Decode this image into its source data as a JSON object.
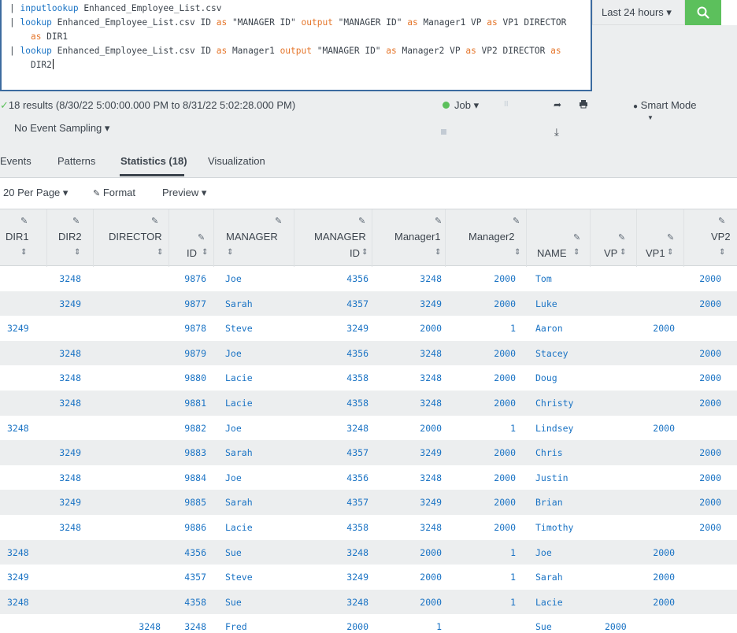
{
  "search": {
    "line1_pipe": "| ",
    "line1_cmd": "inputlookup",
    "line1_rest": " Enhanced_Employee_List.csv",
    "line2_pipe": "| ",
    "line2_cmd": "lookup",
    "line2_a": " Enhanced_Employee_List.csv ID ",
    "line2_as1": "as",
    "line2_b": " \"MANAGER ID\" ",
    "line2_output": "output",
    "line2_c": " \"MANAGER ID\" ",
    "line2_as2": "as",
    "line2_d": " Manager1 VP ",
    "line2_as3": "as",
    "line2_e": " VP1 DIRECTOR",
    "line3_as": "as",
    "line3_rest": " DIR1",
    "line4_pipe": "| ",
    "line4_cmd": "lookup",
    "line4_a": " Enhanced_Employee_List.csv ID ",
    "line4_as1": "as",
    "line4_b": " Manager1 ",
    "line4_output": "output",
    "line4_c": " \"MANAGER ID\" ",
    "line4_as2": "as",
    "line4_d": " Manager2 VP ",
    "line4_as3": "as",
    "line4_e": " VP2 DIRECTOR ",
    "line4_as4": "as",
    "line5_rest": "DIR2"
  },
  "time_picker": "Last 24 hours ▾",
  "status": {
    "check": "✓",
    "results": "18 results (8/30/22 5:00:00.000 PM to 8/31/22 5:02:28.000 PM)",
    "sampling": "No Event Sampling ▾",
    "job": "Job ▾",
    "pause": "II",
    "share_icon": "➦",
    "print_icon": "🖶",
    "export_icon": "⤓",
    "smart_mode": "Smart Mode",
    "smart_caret": "▼",
    "smart_icon": "💡"
  },
  "tabs": [
    {
      "label": "Events"
    },
    {
      "label": "Patterns"
    },
    {
      "label": "Statistics (18)"
    },
    {
      "label": "Visualization"
    }
  ],
  "controls": {
    "per_page": "20 Per Page ▾",
    "format": "Format",
    "preview": "Preview ▾"
  },
  "columns": {
    "dir1": "DIR1",
    "dir2": "DIR2",
    "director": "DIRECTOR",
    "id": "ID",
    "manager": "MANAGER",
    "manager_id_1": "MANAGER",
    "manager_id_2": "ID",
    "manager1": "Manager1",
    "manager2": "Manager2",
    "name": "NAME",
    "vp": "VP",
    "vp1": "VP1",
    "vp2": "VP2",
    "sort_glyph": "⇕",
    "edit_glyph": "✎"
  },
  "rows": [
    {
      "dir1": "",
      "dir2": "3248",
      "director": "",
      "id": "9876",
      "manager": "Joe",
      "manager_id": "4356",
      "manager1": "3248",
      "manager2": "2000",
      "name": "Tom",
      "vp": "",
      "vp1": "",
      "vp2": "2000"
    },
    {
      "dir1": "",
      "dir2": "3249",
      "director": "",
      "id": "9877",
      "manager": "Sarah",
      "manager_id": "4357",
      "manager1": "3249",
      "manager2": "2000",
      "name": "Luke",
      "vp": "",
      "vp1": "",
      "vp2": "2000"
    },
    {
      "dir1": "3249",
      "dir2": "",
      "director": "",
      "id": "9878",
      "manager": "Steve",
      "manager_id": "3249",
      "manager1": "2000",
      "manager2": "1",
      "name": "Aaron",
      "vp": "",
      "vp1": "2000",
      "vp2": ""
    },
    {
      "dir1": "",
      "dir2": "3248",
      "director": "",
      "id": "9879",
      "manager": "Joe",
      "manager_id": "4356",
      "manager1": "3248",
      "manager2": "2000",
      "name": "Stacey",
      "vp": "",
      "vp1": "",
      "vp2": "2000"
    },
    {
      "dir1": "",
      "dir2": "3248",
      "director": "",
      "id": "9880",
      "manager": "Lacie",
      "manager_id": "4358",
      "manager1": "3248",
      "manager2": "2000",
      "name": "Doug",
      "vp": "",
      "vp1": "",
      "vp2": "2000"
    },
    {
      "dir1": "",
      "dir2": "3248",
      "director": "",
      "id": "9881",
      "manager": "Lacie",
      "manager_id": "4358",
      "manager1": "3248",
      "manager2": "2000",
      "name": "Christy",
      "vp": "",
      "vp1": "",
      "vp2": "2000"
    },
    {
      "dir1": "3248",
      "dir2": "",
      "director": "",
      "id": "9882",
      "manager": "Joe",
      "manager_id": "3248",
      "manager1": "2000",
      "manager2": "1",
      "name": "Lindsey",
      "vp": "",
      "vp1": "2000",
      "vp2": ""
    },
    {
      "dir1": "",
      "dir2": "3249",
      "director": "",
      "id": "9883",
      "manager": "Sarah",
      "manager_id": "4357",
      "manager1": "3249",
      "manager2": "2000",
      "name": "Chris",
      "vp": "",
      "vp1": "",
      "vp2": "2000"
    },
    {
      "dir1": "",
      "dir2": "3248",
      "director": "",
      "id": "9884",
      "manager": "Joe",
      "manager_id": "4356",
      "manager1": "3248",
      "manager2": "2000",
      "name": "Justin",
      "vp": "",
      "vp1": "",
      "vp2": "2000"
    },
    {
      "dir1": "",
      "dir2": "3249",
      "director": "",
      "id": "9885",
      "manager": "Sarah",
      "manager_id": "4357",
      "manager1": "3249",
      "manager2": "2000",
      "name": "Brian",
      "vp": "",
      "vp1": "",
      "vp2": "2000"
    },
    {
      "dir1": "",
      "dir2": "3248",
      "director": "",
      "id": "9886",
      "manager": "Lacie",
      "manager_id": "4358",
      "manager1": "3248",
      "manager2": "2000",
      "name": "Timothy",
      "vp": "",
      "vp1": "",
      "vp2": "2000"
    },
    {
      "dir1": "3248",
      "dir2": "",
      "director": "",
      "id": "4356",
      "manager": "Sue",
      "manager_id": "3248",
      "manager1": "2000",
      "manager2": "1",
      "name": "Joe",
      "vp": "",
      "vp1": "2000",
      "vp2": ""
    },
    {
      "dir1": "3249",
      "dir2": "",
      "director": "",
      "id": "4357",
      "manager": "Steve",
      "manager_id": "3249",
      "manager1": "2000",
      "manager2": "1",
      "name": "Sarah",
      "vp": "",
      "vp1": "2000",
      "vp2": ""
    },
    {
      "dir1": "3248",
      "dir2": "",
      "director": "",
      "id": "4358",
      "manager": "Sue",
      "manager_id": "3248",
      "manager1": "2000",
      "manager2": "1",
      "name": "Lacie",
      "vp": "",
      "vp1": "2000",
      "vp2": ""
    },
    {
      "dir1": "",
      "dir2": "",
      "director": "3248",
      "id": "3248",
      "manager": "Fred",
      "manager_id": "2000",
      "manager1": "1",
      "manager2": "",
      "name": "Sue",
      "vp": "2000",
      "vp1": "",
      "vp2": ""
    }
  ]
}
